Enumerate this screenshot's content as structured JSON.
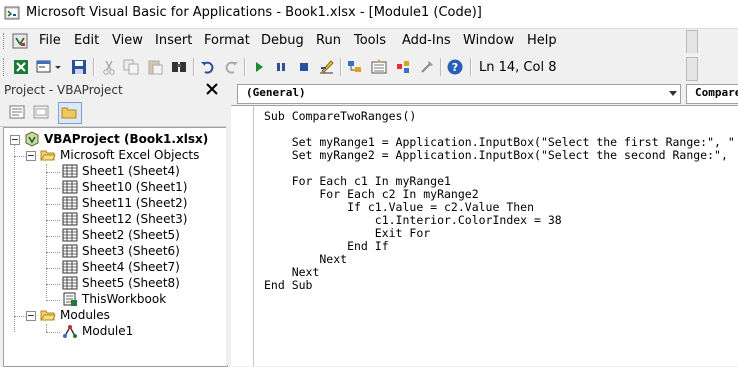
{
  "window": {
    "title": "Microsoft Visual Basic for Applications - Book1.xlsx - [Module1 (Code)]"
  },
  "menu": {
    "file": "File",
    "edit": "Edit",
    "view": "View",
    "insert": "Insert",
    "format": "Format",
    "debug": "Debug",
    "run": "Run",
    "tools": "Tools",
    "addins": "Add-Ins",
    "window": "Window",
    "help": "Help"
  },
  "toolbar": {
    "cursor_position": "Ln 14, Col 8"
  },
  "project": {
    "title": "Project - VBAProject",
    "root": "VBAProject (Book1.xlsx)",
    "excel_objects": "Microsoft Excel Objects",
    "sheets": [
      "Sheet1 (Sheet4)",
      "Sheet10 (Sheet1)",
      "Sheet11 (Sheet2)",
      "Sheet12 (Sheet3)",
      "Sheet2 (Sheet5)",
      "Sheet3 (Sheet6)",
      "Sheet4 (Sheet7)",
      "Sheet5 (Sheet8)"
    ],
    "workbook": "ThisWorkbook",
    "modules": "Modules",
    "module1": "Module1"
  },
  "code": {
    "object_combo": "(General)",
    "proc_combo": "Compare",
    "lines": [
      "Sub CompareTwoRanges()",
      "",
      "    Set myRange1 = Application.InputBox(\"Select the first Range:\", \"",
      "    Set myRange2 = Application.InputBox(\"Select the second Range:\",",
      "",
      "    For Each c1 In myRange1",
      "        For Each c2 In myRange2",
      "            If c1.Value = c2.Value Then",
      "                c1.Interior.ColorIndex = 38",
      "                Exit For",
      "            End If",
      "        Next",
      "    Next",
      "End Sub"
    ]
  }
}
